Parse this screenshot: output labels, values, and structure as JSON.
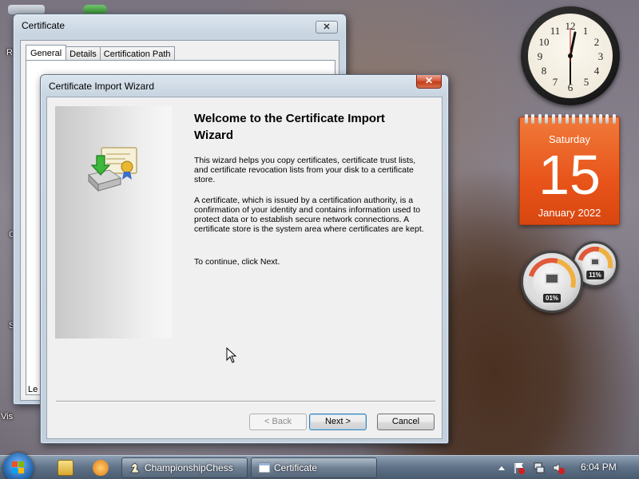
{
  "desktop": {
    "labels": [
      "R",
      "C",
      "S",
      "Vis"
    ]
  },
  "gadgets": {
    "calendar": {
      "day_name": "Saturday",
      "date": "15",
      "month_year": "January 2022"
    },
    "cpu_meter": {
      "cpu_percent": "01%",
      "memory_percent": "11%"
    }
  },
  "certificate_window": {
    "title": "Certificate",
    "tabs": [
      "General",
      "Details",
      "Certification Path"
    ],
    "active_tab": "General",
    "partial_label": "Le"
  },
  "wizard": {
    "title": "Certificate Import Wizard",
    "heading": "Welcome to the Certificate Import Wizard",
    "paragraph1": "This wizard helps you copy certificates, certificate trust lists, and certificate revocation lists from your disk to a certificate store.",
    "paragraph2": "A certificate, which is issued by a certification authority, is a confirmation of your identity and contains information used to protect data or to establish secure network connections. A certificate store is the system area where certificates are kept.",
    "paragraph3": "To continue, click Next.",
    "buttons": {
      "back": "< Back",
      "next": "Next >",
      "cancel": "Cancel"
    },
    "close_glyph": "✕"
  },
  "taskbar": {
    "items": [
      {
        "label": "ChampionshipChess"
      },
      {
        "label": "Certificate"
      }
    ],
    "clock": "6:04 PM"
  },
  "colors": {
    "calendar_orange": "#e8541a",
    "close_red": "#c23c1a",
    "default_button_border": "#3c7fb1"
  }
}
